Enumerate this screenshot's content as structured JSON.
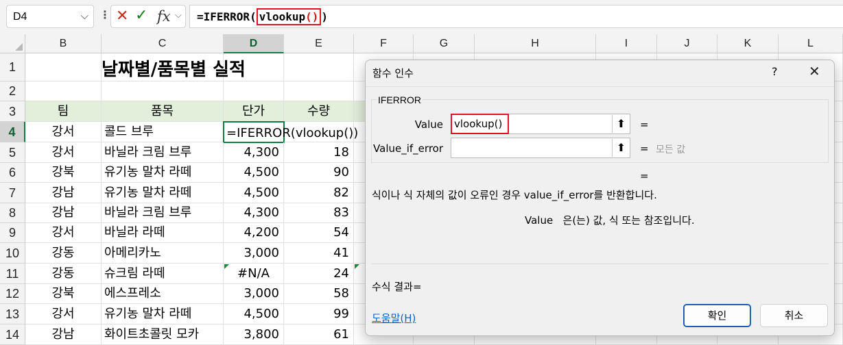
{
  "formula_bar": {
    "name_box": "D4",
    "cancel_icon": "close-x-icon",
    "confirm_icon": "checkmark-icon",
    "fx_label": "fx",
    "formula_prefix": "=IFERROR(",
    "formula_fn": "vlookup",
    "formula_paren_open": "(",
    "formula_paren_close": ")",
    "formula_suffix": ")"
  },
  "sheet": {
    "columns": [
      "B",
      "C",
      "D",
      "E",
      "F",
      "G",
      "H",
      "I",
      "J",
      "K",
      "L"
    ],
    "selected_column": "D",
    "row_numbers": [
      "1",
      "2",
      "3",
      "4",
      "5",
      "6",
      "7",
      "8",
      "9",
      "10",
      "11",
      "12",
      "13",
      "14"
    ],
    "selected_row": "4",
    "title": "날짜별/품목별 실적",
    "header": {
      "team": "팀",
      "item": "품목",
      "price": "단가",
      "qty": "수량"
    },
    "rows": [
      {
        "team": "강서",
        "item": "콜드 브루",
        "price": "=IFERROR(vlookup())",
        "qty": ""
      },
      {
        "team": "강서",
        "item": "바닐라 크림 브루",
        "price": "4,300",
        "qty": "18"
      },
      {
        "team": "강북",
        "item": "유기농 말차 라떼",
        "price": "4,500",
        "qty": "90"
      },
      {
        "team": "강남",
        "item": "유기농 말차 라떼",
        "price": "4,500",
        "qty": "82"
      },
      {
        "team": "강남",
        "item": "바닐라 크림 브루",
        "price": "4,300",
        "qty": "83"
      },
      {
        "team": "강서",
        "item": "바닐라 라떼",
        "price": "4,200",
        "qty": "54"
      },
      {
        "team": "강동",
        "item": "아메리카노",
        "price": "3,000",
        "qty": "41"
      },
      {
        "team": "강동",
        "item": "슈크림 라떼",
        "price": "#N/A",
        "qty": "24"
      },
      {
        "team": "강북",
        "item": "에스프레소",
        "price": "3,000",
        "qty": "58"
      },
      {
        "team": "강서",
        "item": "유기농 말차 라떼",
        "price": "4,500",
        "qty": "99"
      },
      {
        "team": "강남",
        "item": "화이트초콜릿 모카",
        "price": "3,800",
        "qty": "61"
      }
    ]
  },
  "dialog": {
    "title": "함수 인수",
    "help_glyph": "?",
    "close_glyph": "✕",
    "function_name": "IFERROR",
    "args": [
      {
        "label": "Value",
        "value": "vlookup()",
        "equals": "=",
        "hint": ""
      },
      {
        "label": "Value_if_error",
        "value": "",
        "equals": "=",
        "hint": "모든 값"
      }
    ],
    "result_equals": "=",
    "description": "식이나 식 자체의 값이 오류인 경우 value_if_error를 반환합니다.",
    "arg_description_name": "Value",
    "arg_description": "은(는) 값, 식 또는 참조입니다.",
    "formula_result_label": "수식 결과=",
    "help_link": "도움말(H)",
    "ok_label": "확인",
    "cancel_label": "취소"
  }
}
